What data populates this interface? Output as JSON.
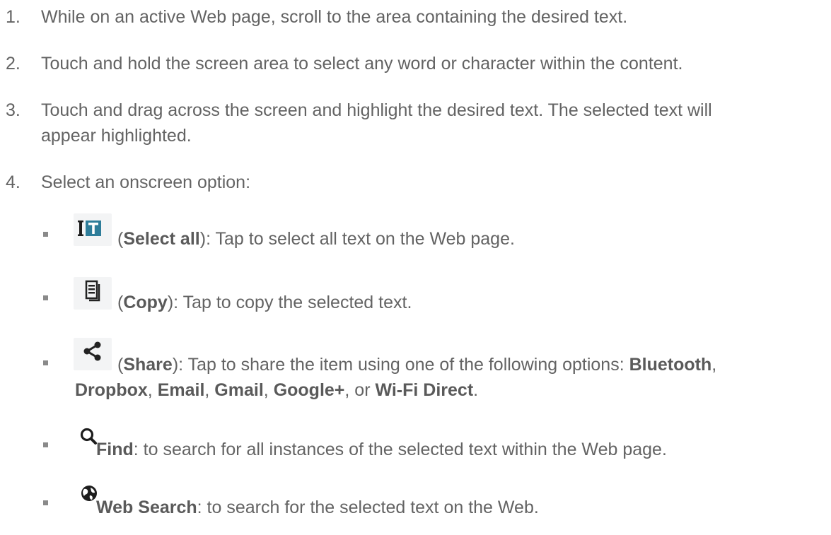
{
  "steps": [
    {
      "num": "1.",
      "text": "While on an active Web page, scroll to the area containing the desired text."
    },
    {
      "num": "2.",
      "text": "Touch and hold the screen area to select any word or character within the content."
    },
    {
      "num": "3.",
      "text_line1": "Touch and drag across the screen and highlight the desired text. The selected text will",
      "text_line2": "appear highlighted."
    },
    {
      "num": "4.",
      "text": "Select an onscreen option:"
    }
  ],
  "options": [
    {
      "icon": "select-all-icon",
      "open": "(",
      "label": "Select all",
      "close": ")",
      "desc": ": Tap to select all text on the Web page."
    },
    {
      "icon": "copy-icon",
      "open": "(",
      "label": "Copy",
      "close": ")",
      "desc": ": Tap to copy the selected text."
    },
    {
      "icon": "share-icon",
      "open": "(",
      "label": "Share",
      "close": ")",
      "desc": ": Tap to share the item using one of the following options: ",
      "share_targets": {
        "bluetooth": "Bluetooth",
        "sep1": ",",
        "dropbox": "Dropbox",
        "sep2": ", ",
        "email": "Email",
        "sep3": ", ",
        "gmail": "Gmail",
        "sep4": ", ",
        "googleplus": "Google+",
        "sep5": ", or ",
        "wifi": "Wi-Fi Direct",
        "end": "."
      }
    },
    {
      "icon": "search-icon",
      "label": "Find",
      "desc": ": to search for all instances of the selected text within the Web page."
    },
    {
      "icon": "globe-icon",
      "label": "Web Search",
      "desc": ": to search for the selected text on the Web."
    }
  ],
  "colors": {
    "text": "#636363",
    "icon": "#2e7d9a",
    "icon_bg": "#f3f4f5"
  }
}
